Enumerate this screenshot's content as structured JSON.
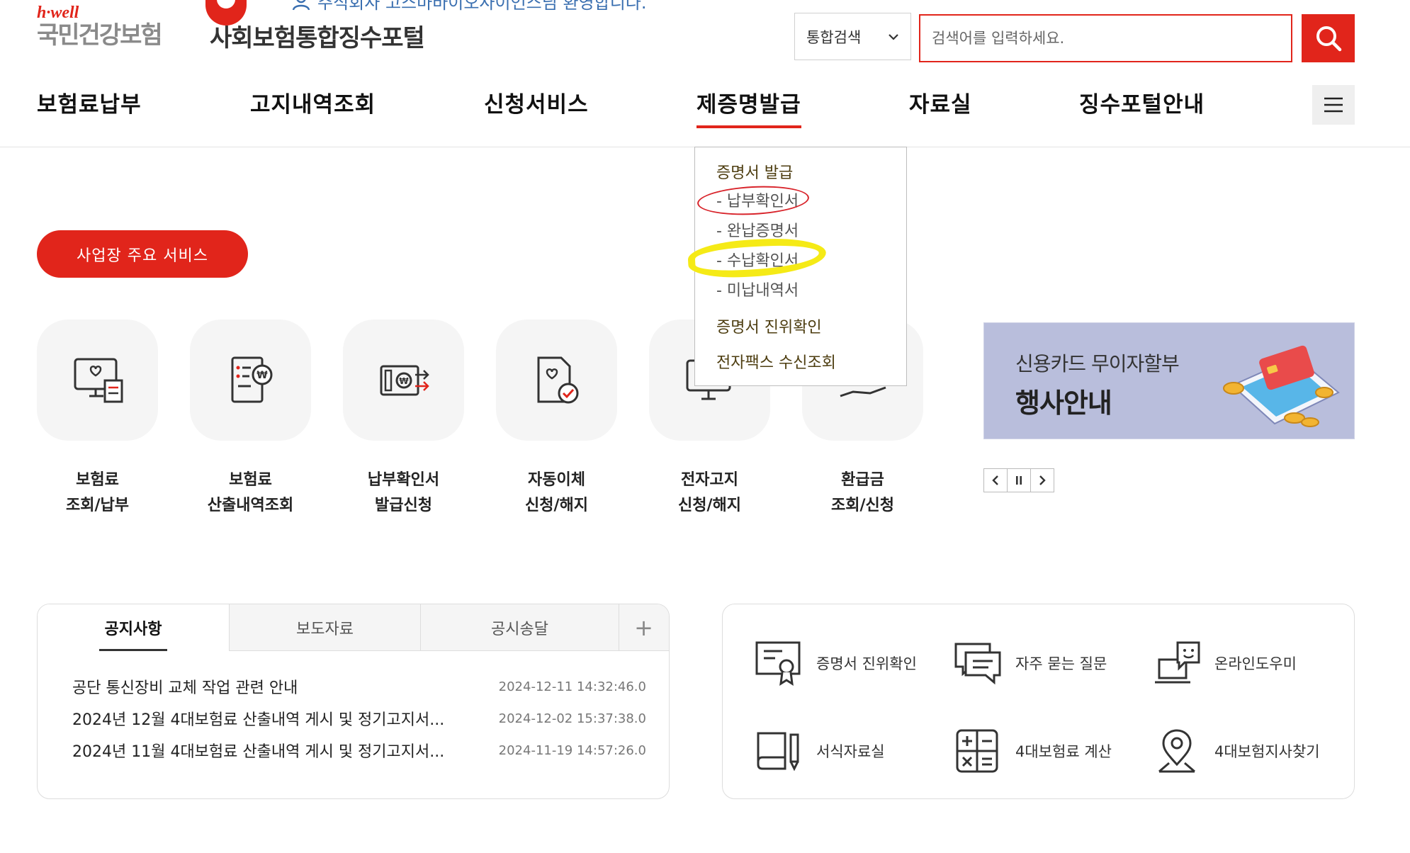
{
  "header": {
    "logo_hwell": "h·well",
    "logo_name": "국민건강보험",
    "portal_title": "사회보험통합징수포털",
    "welcome": "주식회사 고스마바이오사이언스님 환영합니다."
  },
  "search": {
    "select_value": "통합검색",
    "placeholder": "검색어를 입력하세요."
  },
  "gnb": {
    "items": [
      "보험료납부",
      "고지내역조회",
      "신청서비스",
      "제증명발급",
      "자료실",
      "징수포털안내"
    ],
    "active": "제증명발급"
  },
  "dropdown": {
    "head1": "증명서 발급",
    "subs": [
      "- 납부확인서",
      "- 완납증명서",
      "- 수납확인서",
      "- 미납내역서"
    ],
    "head2": "증명서 진위확인",
    "head3": "전자팩스 수신조회"
  },
  "services": {
    "title": "사업장 주요 서비스",
    "items": [
      {
        "line1": "보험료",
        "line2": "조회/납부"
      },
      {
        "line1": "보험료",
        "line2": "산출내역조회"
      },
      {
        "line1": "납부확인서",
        "line2": "발급신청"
      },
      {
        "line1": "자동이체",
        "line2": "신청/해지"
      },
      {
        "line1": "전자고지",
        "line2": "신청/해지"
      },
      {
        "line1": "환급금",
        "line2": "조회/신청"
      }
    ]
  },
  "banner": {
    "subtitle": "신용카드 무이자할부",
    "title": "행사안내"
  },
  "notice": {
    "tabs": [
      "공지사항",
      "보도자료",
      "공시송달"
    ],
    "more": "+",
    "rows": [
      {
        "title": "공단 통신장비 교체 작업 관련 안내",
        "date": "2024-12-11 14:32:46.0"
      },
      {
        "title": "2024년 12월 4대보험료 산출내역 게시 및 정기고지서...",
        "date": "2024-12-02 15:37:38.0"
      },
      {
        "title": "2024년 11월 4대보험료 산출내역 게시 및 정기고지서...",
        "date": "2024-11-19 14:57:26.0"
      }
    ]
  },
  "quick": {
    "items": [
      "증명서 진위확인",
      "자주 묻는 질문",
      "온라인도우미",
      "서식자료실",
      "4대보험료 계산",
      "4대보험지사찾기"
    ]
  },
  "colors": {
    "brand": "#e1251b",
    "banner_bg": "#b9bedc",
    "annot_red": "#d8232a",
    "annot_yellow": "#f5ea16"
  }
}
